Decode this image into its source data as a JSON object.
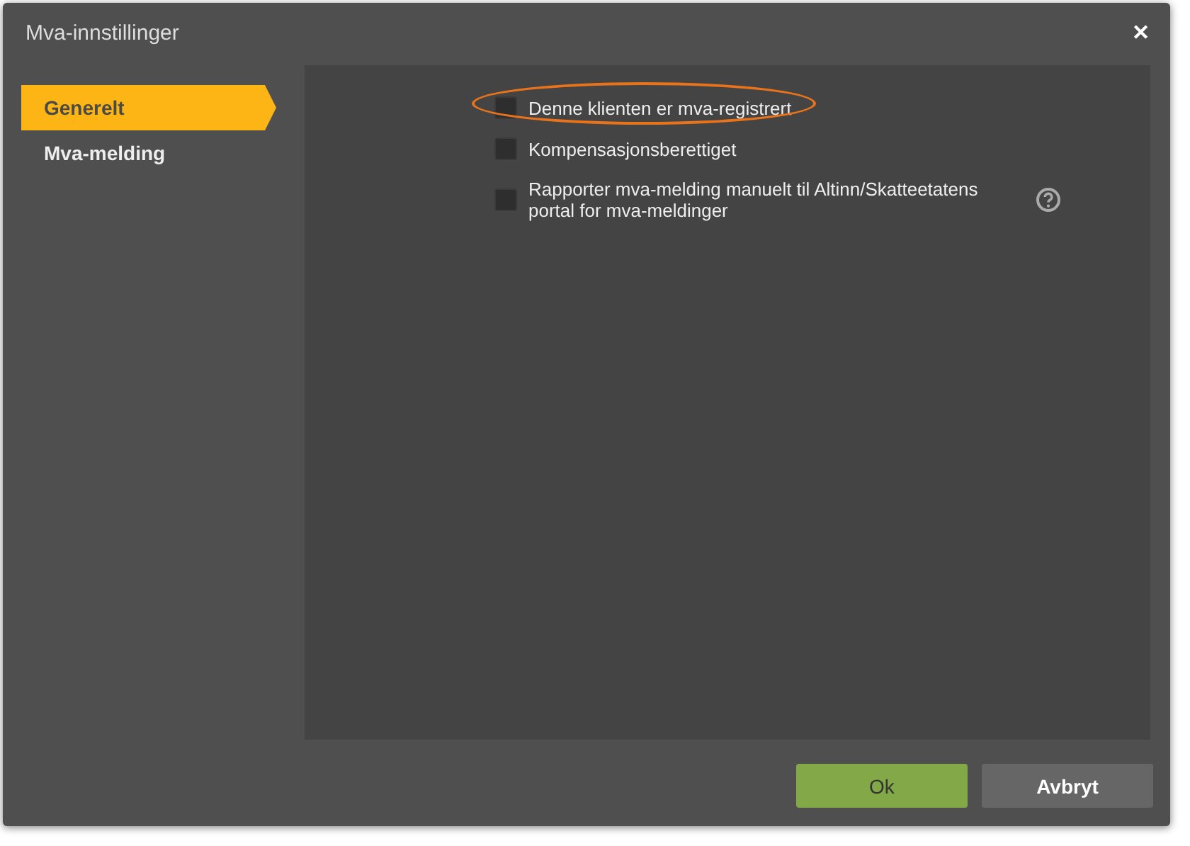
{
  "window": {
    "title": "Mva-innstillinger",
    "close": "✕"
  },
  "sidebar": {
    "items": [
      {
        "label": "Generelt",
        "selected": true
      },
      {
        "label": "Mva-melding",
        "selected": false
      }
    ]
  },
  "options": [
    {
      "label": "Denne klienten er mva-registrert",
      "checked": false,
      "highlighted": true,
      "help": false
    },
    {
      "label": "Kompensasjonsberettiget",
      "checked": false,
      "highlighted": false,
      "help": false
    },
    {
      "label": "Rapporter mva-melding manuelt til Altinn/Skatteetatens portal for mva-meldinger",
      "checked": false,
      "highlighted": false,
      "help": true
    }
  ],
  "buttons": [
    {
      "label": "Ok",
      "kind": "primary"
    },
    {
      "label": "Avbryt",
      "kind": "secondary"
    }
  ]
}
